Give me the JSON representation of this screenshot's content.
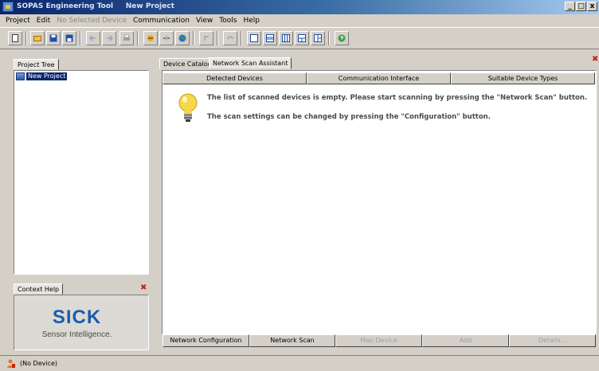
{
  "window": {
    "title": "SOPAS Engineering Tool     New Project",
    "controls": [
      "_",
      "□",
      "x"
    ]
  },
  "menu": [
    {
      "label": "Project",
      "enabled": true
    },
    {
      "label": "Edit",
      "enabled": true
    },
    {
      "label": "No Selected Device",
      "enabled": false
    },
    {
      "label": "Communication",
      "enabled": true
    },
    {
      "label": "View",
      "enabled": true
    },
    {
      "label": "Tools",
      "enabled": true
    },
    {
      "label": "Help",
      "enabled": true
    }
  ],
  "toolbar_icons": [
    "new-file-icon",
    "open-folder-icon",
    "save-icon",
    "save-all-icon",
    "back-arrow-icon",
    "forward-arrow-icon",
    "print-icon",
    "connect-icon",
    "disconnect-icon",
    "globe-icon",
    "undo-icon",
    "redo-icon",
    "layout-1-icon",
    "layout-2-icon",
    "layout-3-icon",
    "layout-4-icon",
    "layout-5-icon",
    "help-icon"
  ],
  "project_tree": {
    "tab": "Project Tree",
    "node": "New Project"
  },
  "context_help": {
    "tab": "Context Help",
    "logo_name": "SICK",
    "logo_tagline": "Sensor Intelligence."
  },
  "main_tabs": [
    {
      "label": "Device Catalog",
      "active": false
    },
    {
      "label": "Network Scan Assistant",
      "active": true
    }
  ],
  "table": {
    "columns": [
      "Detected Devices",
      "Communication Interface",
      "Suitable Device Types"
    ]
  },
  "messages": {
    "line1": "The list of scanned devices is empty. Please start scanning by pressing the \"Network Scan\" button.",
    "line2": "The scan settings can be changed by pressing the \"Configuration\" button."
  },
  "bottom_buttons": [
    {
      "label": "Network Configuration",
      "enabled": true
    },
    {
      "label": "Network Scan",
      "enabled": true
    },
    {
      "label": "Map Device",
      "enabled": false
    },
    {
      "label": "Add",
      "enabled": false
    },
    {
      "label": "Details...",
      "enabled": false
    }
  ],
  "status": {
    "text": "(No Device)"
  },
  "colors": {
    "chrome": "#d4d0c8",
    "title_dark": "#0a246a",
    "brand_blue": "#1a5bb0",
    "close_red": "#d02010"
  }
}
